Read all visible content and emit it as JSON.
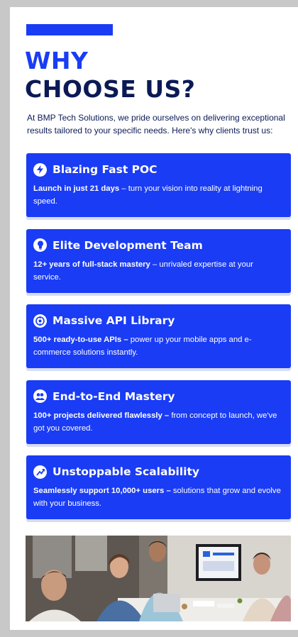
{
  "heading": {
    "line1": "WHY",
    "line2": "CHOOSE US?"
  },
  "intro": "At BMP Tech Solutions, we pride ourselves on delivering exceptional results tailored to your specific needs. Here's why clients trust us:",
  "cards": [
    {
      "icon": "lightning-icon",
      "title": "Blazing Fast POC",
      "bold": "Launch in just 21 days",
      "rest": " – turn your vision into reality at lightning speed."
    },
    {
      "icon": "lightbulb-icon",
      "title": "Elite Development Team",
      "bold": "12+ years of full-stack mastery",
      "rest": " – unrivaled expertise at your service."
    },
    {
      "icon": "api-icon",
      "title": "Massive API Library",
      "bold": "500+ ready-to-use APIs –",
      "rest": " power up your mobile apps and e-commerce solutions instantly."
    },
    {
      "icon": "team-icon",
      "title": "End-to-End Mastery",
      "bold": "100+ projects delivered flawlessly –",
      "rest": " from concept to launch, we've got you covered."
    },
    {
      "icon": "growth-icon",
      "title": "Unstoppable Scalability",
      "bold": "Seamlessly support 10,000+ users –",
      "rest": " solutions that grow and evolve with your business."
    }
  ],
  "colors": {
    "brand": "#1a3cf5",
    "navy": "#0b1a55"
  }
}
